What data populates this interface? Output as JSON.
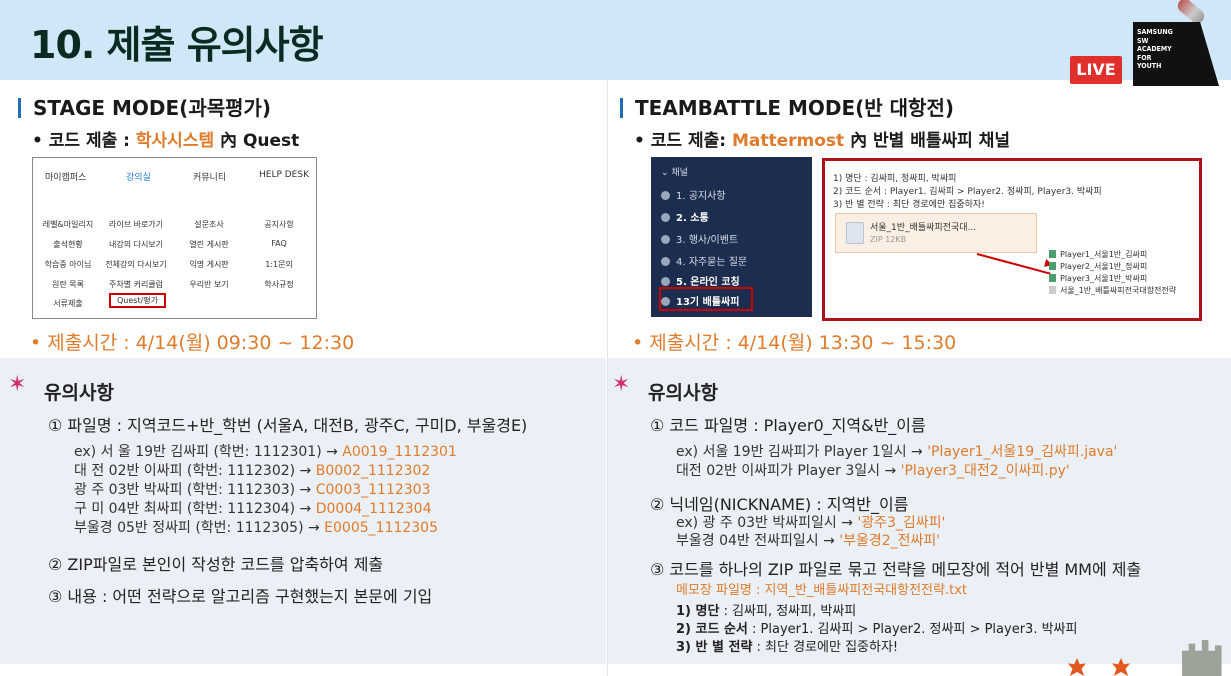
{
  "header": {
    "title": "10. 제출 유의사항",
    "live_badge": "LIVE",
    "logo_text": "SAMSUNG\nSW\nACADEMY\nFOR\nYOUTH"
  },
  "left": {
    "mode_title": "STAGE MODE(과목평가)",
    "submit_prefix": "• 코드 제출 : ",
    "submit_highlight": "학사시스템",
    "submit_suffix": " 內 Quest",
    "portal": {
      "nav": [
        "마이캠퍼스",
        "강의실",
        "커뮤니티",
        "HELP DESK"
      ],
      "rows": [
        [
          "레벨&마일리지",
          "라이브 바로가기",
          "설문조사",
          "공지사항"
        ],
        [
          "출석현황",
          "내강의 다시보기",
          "열린 게시판",
          "FAQ"
        ],
        [
          "학습중 아이님",
          "전체강의 다시보기",
          "익명 게시판",
          "1:1문의"
        ],
        [
          "원란 목록",
          "주차별 커리큘럼",
          "우리반 보기",
          "학사규정"
        ],
        [
          "서류제출",
          "Quest/평가",
          "",
          ""
        ]
      ]
    },
    "time": "• 제출시간 : 4/14(월) 09:30 ~  12:30",
    "notes_title": "유의사항",
    "items": [
      "①  파일명 : 지역코드+반_학번 (서울A, 대전B, 광주C, 구미D, 부울경E)",
      "②  ZIP파일로 본인이 작성한 코드를 압축하여 제출",
      "③  내용 : 어떤 전략으로 알고리즘 구현했는지 본문에 기입"
    ],
    "examples": [
      {
        "prefix": "ex) 서  울  19반  김싸피 (학번: 1112301) → ",
        "value": "A0019_1112301"
      },
      {
        "prefix": "       대  전  02반  이싸피 (학번: 1112302) → ",
        "value": "B0002_1112302"
      },
      {
        "prefix": "       광  주  03반  박싸피 (학번: 1112303) → ",
        "value": "C0003_1112303"
      },
      {
        "prefix": "       구  미  04반  최싸피 (학번: 1112304) → ",
        "value": "D0004_1112304"
      },
      {
        "prefix": "       부울경  05반  정싸피 (학번: 1112305) → ",
        "value": "E0005_1112305"
      }
    ]
  },
  "right": {
    "mode_title": "TEAMBATTLE MODE(반 대항전)",
    "submit_prefix": "• 코드 제출: ",
    "submit_highlight": "Mattermost",
    "submit_suffix": " 內 반별 배틀싸피 채널",
    "channels": {
      "header": "채널",
      "items": [
        "1. 공지사항",
        "2. 소통",
        "3. 행사/이벤트",
        "4. 자주묻는 질문",
        "5. 온라인 코칭",
        "13기 배틀싸피"
      ]
    },
    "message": {
      "lines": [
        "1) 명단 : 김싸피, 정싸피, 박싸피",
        "2) 코드 순서 : Player1. 김싸피 > Player2. 정싸피, Player3. 박싸피",
        "3) 반 별 전략 : 최단 경로에만 집중하자!"
      ],
      "attachment_name": "서울_1반_배틀싸피전국대...",
      "attachment_size": "ZIP 12KB",
      "files": [
        "Player1_서울1반_김싸피",
        "Player2_서울1반_정싸피",
        "Player3_서울1반_박싸피",
        "서울_1반_배틀싸피전국대항전전략"
      ]
    },
    "time": "• 제출시간 : 4/14(월) 13:30 ~  15:30",
    "notes_title": "유의사항",
    "item1": "①  코드 파일명 : Player0_지역&반_이름",
    "ex1": [
      {
        "prefix": "ex) 서울 19반 김싸피가 Player 1일시 → ",
        "value": "'Player1_서울19_김싸피.java'"
      },
      {
        "prefix": "      대전 02반 이싸피가 Player 3일시 → ",
        "value": "'Player3_대전2_이싸피.py'"
      }
    ],
    "item2": "②  닉네임(NICKNAME) : 지역반_이름",
    "ex2": [
      {
        "prefix": "ex) 광 주 03반 박싸피일시 → ",
        "value": "'광주3_김싸피'"
      },
      {
        "prefix": "      부울경 04반 전싸피일시 → ",
        "value": "'부울경2_전싸피'"
      }
    ],
    "item3": "③  코드를 하나의 ZIP 파일로 묶고 전략을 메모장에 적어 반별 MM에 제출",
    "memo_name": "메모장 파일명 : 지역_반_배틀싸피전국대항전전략.txt",
    "memo_lines": [
      {
        "label": "1) 명단",
        "value": " : 김싸피, 정싸피, 박싸피"
      },
      {
        "label": "2) 코드 순서",
        "value": " : Player1. 김싸피 > Player2. 정싸피 > Player3. 박싸피"
      },
      {
        "label": "3) 반 별 전략",
        "value": " : 최단 경로에만 집중하자!"
      }
    ]
  }
}
